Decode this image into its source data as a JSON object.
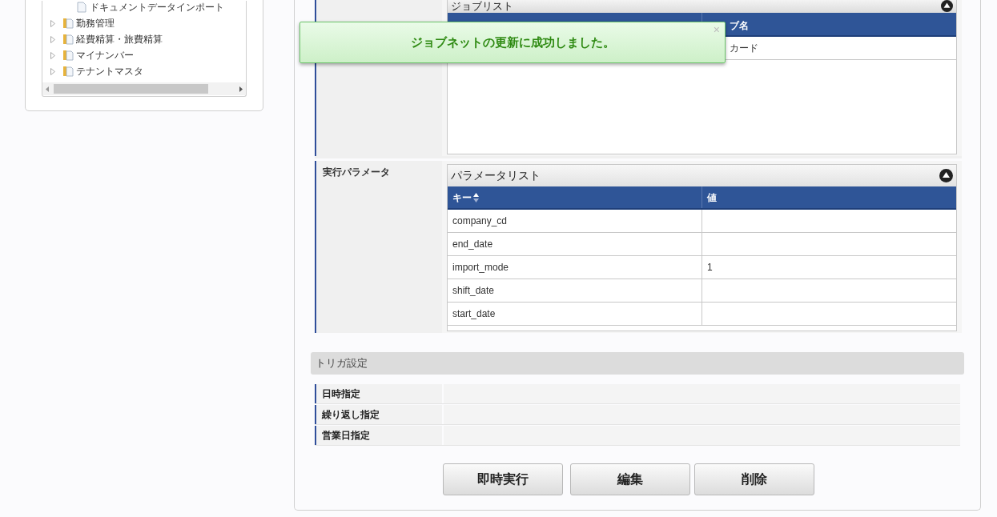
{
  "tree": {
    "items": [
      {
        "label": "ドキュメントデータインポート",
        "kind": "document"
      },
      {
        "label": "勤務管理",
        "kind": "folder",
        "expanded": false
      },
      {
        "label": "経費精算・旅費精算",
        "kind": "folder",
        "expanded": false
      },
      {
        "label": "マイナンバー",
        "kind": "folder",
        "expanded": false
      },
      {
        "label": "テナントマスタ",
        "kind": "folder",
        "expanded": false
      }
    ]
  },
  "job_list": {
    "title": "ジョブリスト",
    "columns": [
      "",
      "ブ名"
    ],
    "rows": [
      [
        "",
        "カード"
      ]
    ]
  },
  "parameters": {
    "label": "実行パラメータ",
    "title": "パラメータリスト",
    "columns": [
      "キー",
      "値"
    ],
    "rows": [
      [
        "company_cd",
        ""
      ],
      [
        "end_date",
        ""
      ],
      [
        "import_mode",
        "1"
      ],
      [
        "shift_date",
        ""
      ],
      [
        "start_date",
        ""
      ]
    ]
  },
  "trigger": {
    "title": "トリガ設定",
    "rows": [
      "日時指定",
      "繰り返し指定",
      "営業日指定"
    ]
  },
  "buttons": [
    "即時実行",
    "編集",
    "削除"
  ],
  "toast": {
    "message": "ジョブネットの更新に成功しました。",
    "close": "×"
  }
}
